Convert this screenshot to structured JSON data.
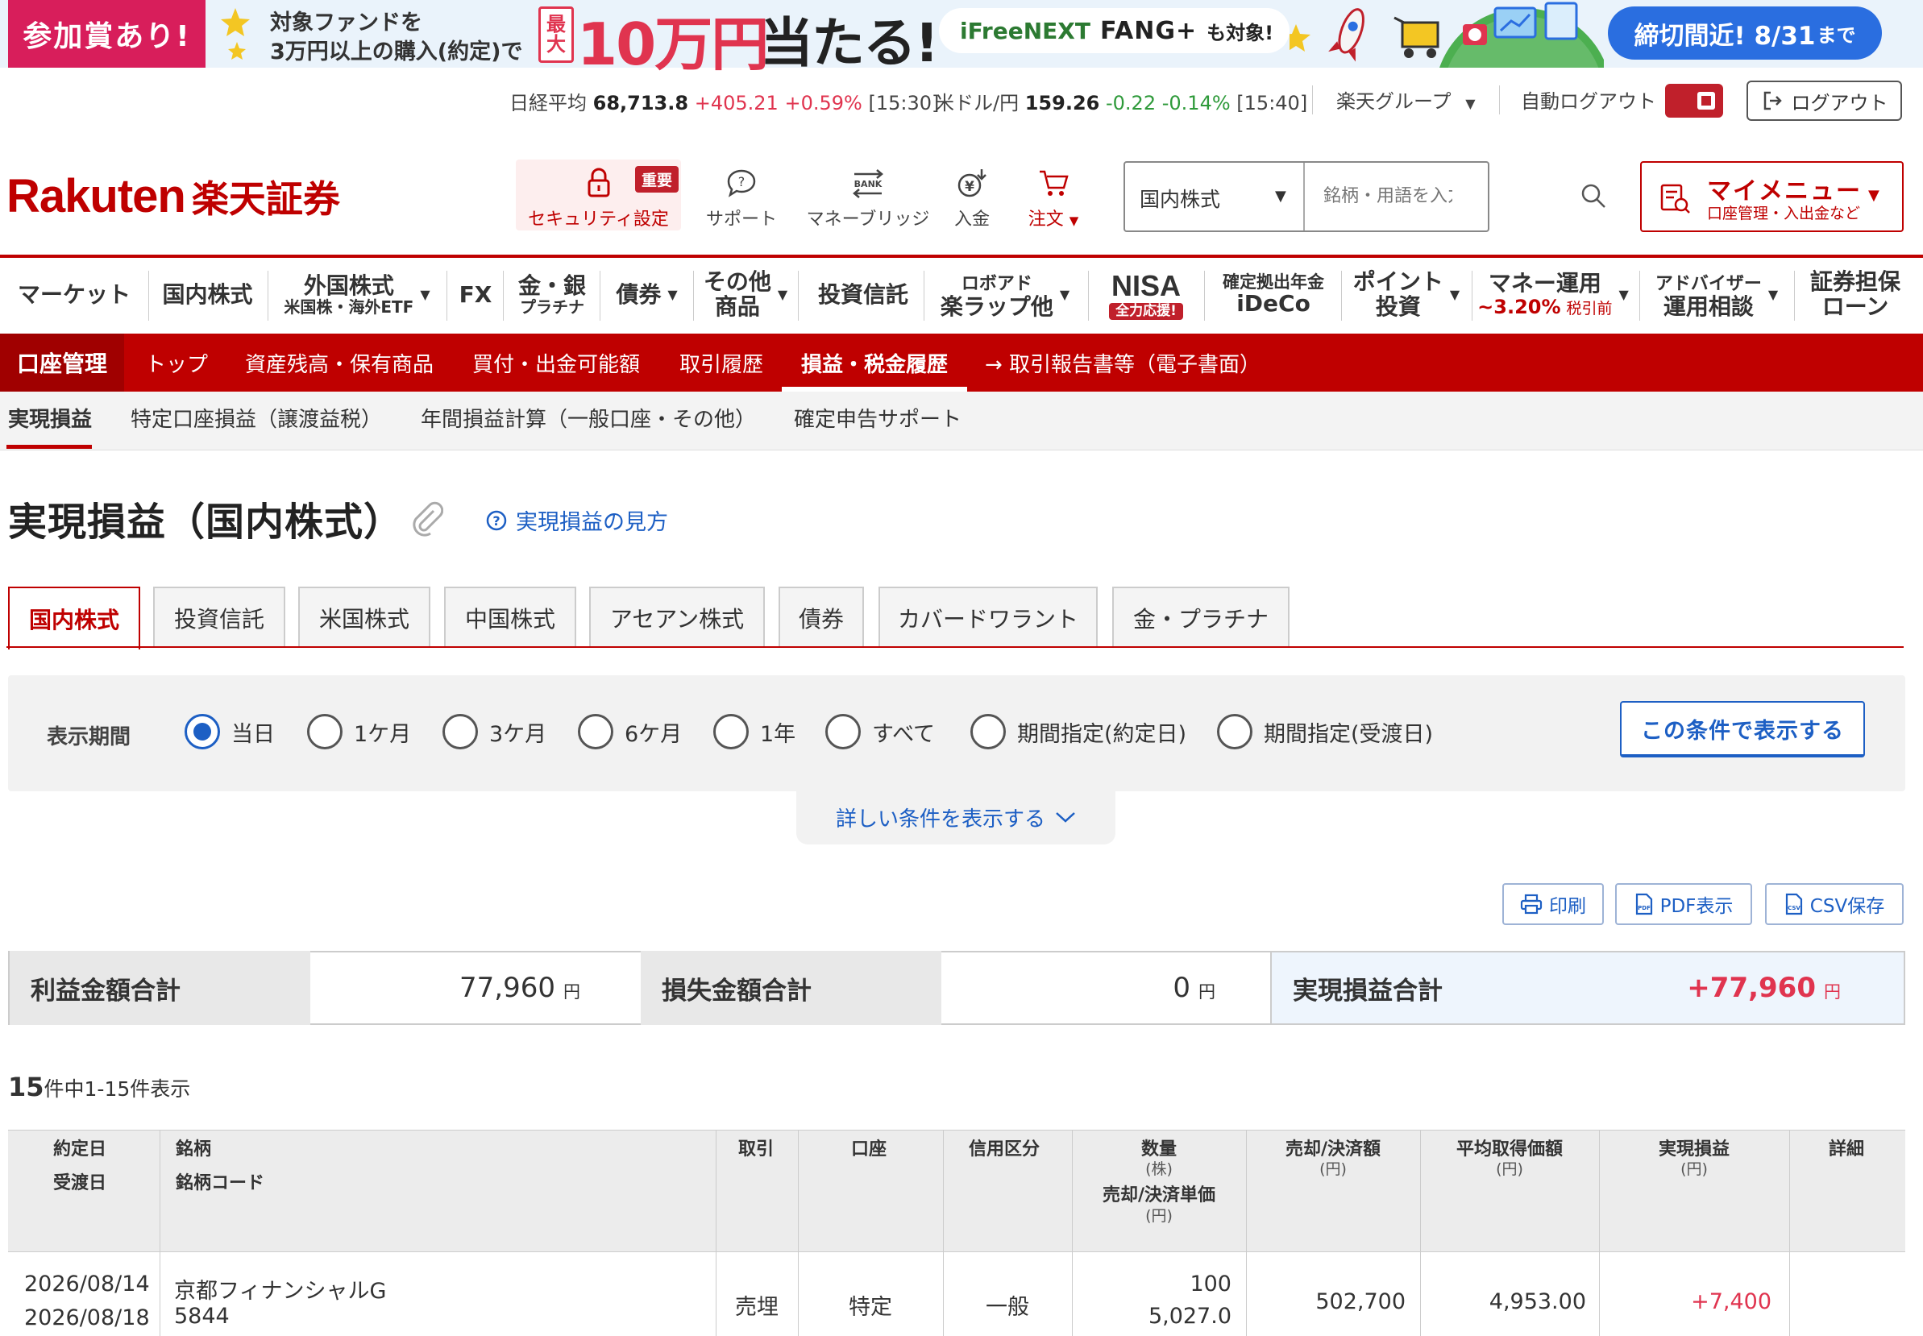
{
  "banner": {
    "badge": "参加賞あり!",
    "line1": "対象ファンドを",
    "line2": "3万円以上の購入(約定)で",
    "max": "最大",
    "prize": "10万円",
    "prize_tail": "当たる!",
    "fund_prefix": "iFreeNEXT",
    "fund_name": "FANG+",
    "fund_suffix": "も対象!",
    "deadline": "締切間近! 8/31",
    "deadline_suffix": "まで"
  },
  "ticker": {
    "nikkei_label": "日経平均",
    "nikkei_value": "68,713.8",
    "nikkei_change": "+405.21",
    "nikkei_pct": "+0.59%",
    "nikkei_time": "[15:30]",
    "usdjpy_label": "米ドル/円",
    "usdjpy_value": "159.26",
    "usdjpy_change": "-0.22",
    "usdjpy_pct": "-0.14%",
    "usdjpy_time": "[15:40]",
    "group": "楽天グループ",
    "auto_logout": "自動ログアウト",
    "logout": "ログアウト"
  },
  "header": {
    "logo_en": "Rakuten",
    "logo_jp": "楽天証券",
    "security_label": "セキュリティ設定",
    "security_badge": "重要",
    "support": "サポート",
    "money_bridge": "マネーブリッジ",
    "deposit": "入金",
    "order": "注文",
    "bank_label": "BANK",
    "search_category": "国内株式",
    "search_placeholder": "銘柄・用語を入力",
    "mymenu_title": "マイメニュー",
    "mymenu_sub": "口座管理・入出金など"
  },
  "gnav": {
    "market": "マーケット",
    "domestic": "国内株式",
    "foreign": "外国株式",
    "foreign_sub": "米国株・海外ETF",
    "fx": "FX",
    "gold": "金・銀",
    "gold_sub": "プラチナ",
    "bond": "債券",
    "other": "その他",
    "other_sub": "商品",
    "fund": "投資信託",
    "robo": "ロボアド",
    "robo_sub": "楽ラップ他",
    "nisa": "NISA",
    "nisa_badge": "全力応援!",
    "ideco_top": "確定拠出年金",
    "ideco": "iDeCo",
    "point": "ポイント",
    "point_sub": "投資",
    "money": "マネー運用",
    "money_rate": "~3.20%",
    "money_rate_sub": "税引前",
    "advisor": "アドバイザー",
    "advisor_sub": "運用相談",
    "loan": "証券担保",
    "loan_sub": "ローン"
  },
  "account_bar": {
    "label": "口座管理",
    "items": [
      "トップ",
      "資産残高・保有商品",
      "買付・出金可能額",
      "取引履歴",
      "損益・税金履歴",
      "→ 取引報告書等（電子書面）"
    ]
  },
  "subnav": {
    "items": [
      "実現損益",
      "特定口座損益（譲渡益税）",
      "年間損益計算（一般口座・その他）",
      "確定申告サポート"
    ]
  },
  "page": {
    "title": "実現損益（国内株式）",
    "help": "実現損益の見方"
  },
  "tabs": [
    "国内株式",
    "投資信託",
    "米国株式",
    "中国株式",
    "アセアン株式",
    "債券",
    "カバードワラント",
    "金・プラチナ"
  ],
  "filter": {
    "label": "表示期間",
    "options": [
      "当日",
      "1ケ月",
      "3ケ月",
      "6ケ月",
      "1年",
      "すべて",
      "期間指定(約定日)",
      "期間指定(受渡日)"
    ],
    "selected": "当日",
    "submit": "この条件で表示する",
    "details": "詳しい条件を表示する"
  },
  "actions": {
    "print": "印刷",
    "pdf": "PDF表示",
    "csv": "CSV保存"
  },
  "summary": {
    "profit_label": "利益金額合計",
    "profit_value": "77,960",
    "loss_label": "損失金額合計",
    "loss_value": "0",
    "total_label": "実現損益合計",
    "total_value": "+77,960",
    "unit": "円"
  },
  "count": {
    "total": "15",
    "text": "件中1-15件表示"
  },
  "table": {
    "headers": {
      "date1": "約定日",
      "date2": "受渡日",
      "name1": "銘柄",
      "name2": "銘柄コード",
      "trade": "取引",
      "account": "口座",
      "credit": "信用区分",
      "qty": "数量",
      "qty_unit": "(株)",
      "price": "売却/決済単価",
      "price_unit": "(円)",
      "amount": "売却/決済額",
      "amount_unit": "(円)",
      "avg": "平均取得価額",
      "avg_unit": "(円)",
      "pl": "実現損益",
      "pl_unit": "(円)",
      "detail": "詳細"
    },
    "rows": [
      {
        "trade_date": "2026/08/14",
        "settle_date": "2026/08/18",
        "name": "京都フィナンシャルG",
        "code": "5844",
        "trade": "売埋",
        "account": "特定",
        "credit": "一般",
        "qty": "100",
        "price": "5,027.0",
        "amount": "502,700",
        "avg": "4,953.00",
        "pl": "+7,400"
      }
    ]
  }
}
